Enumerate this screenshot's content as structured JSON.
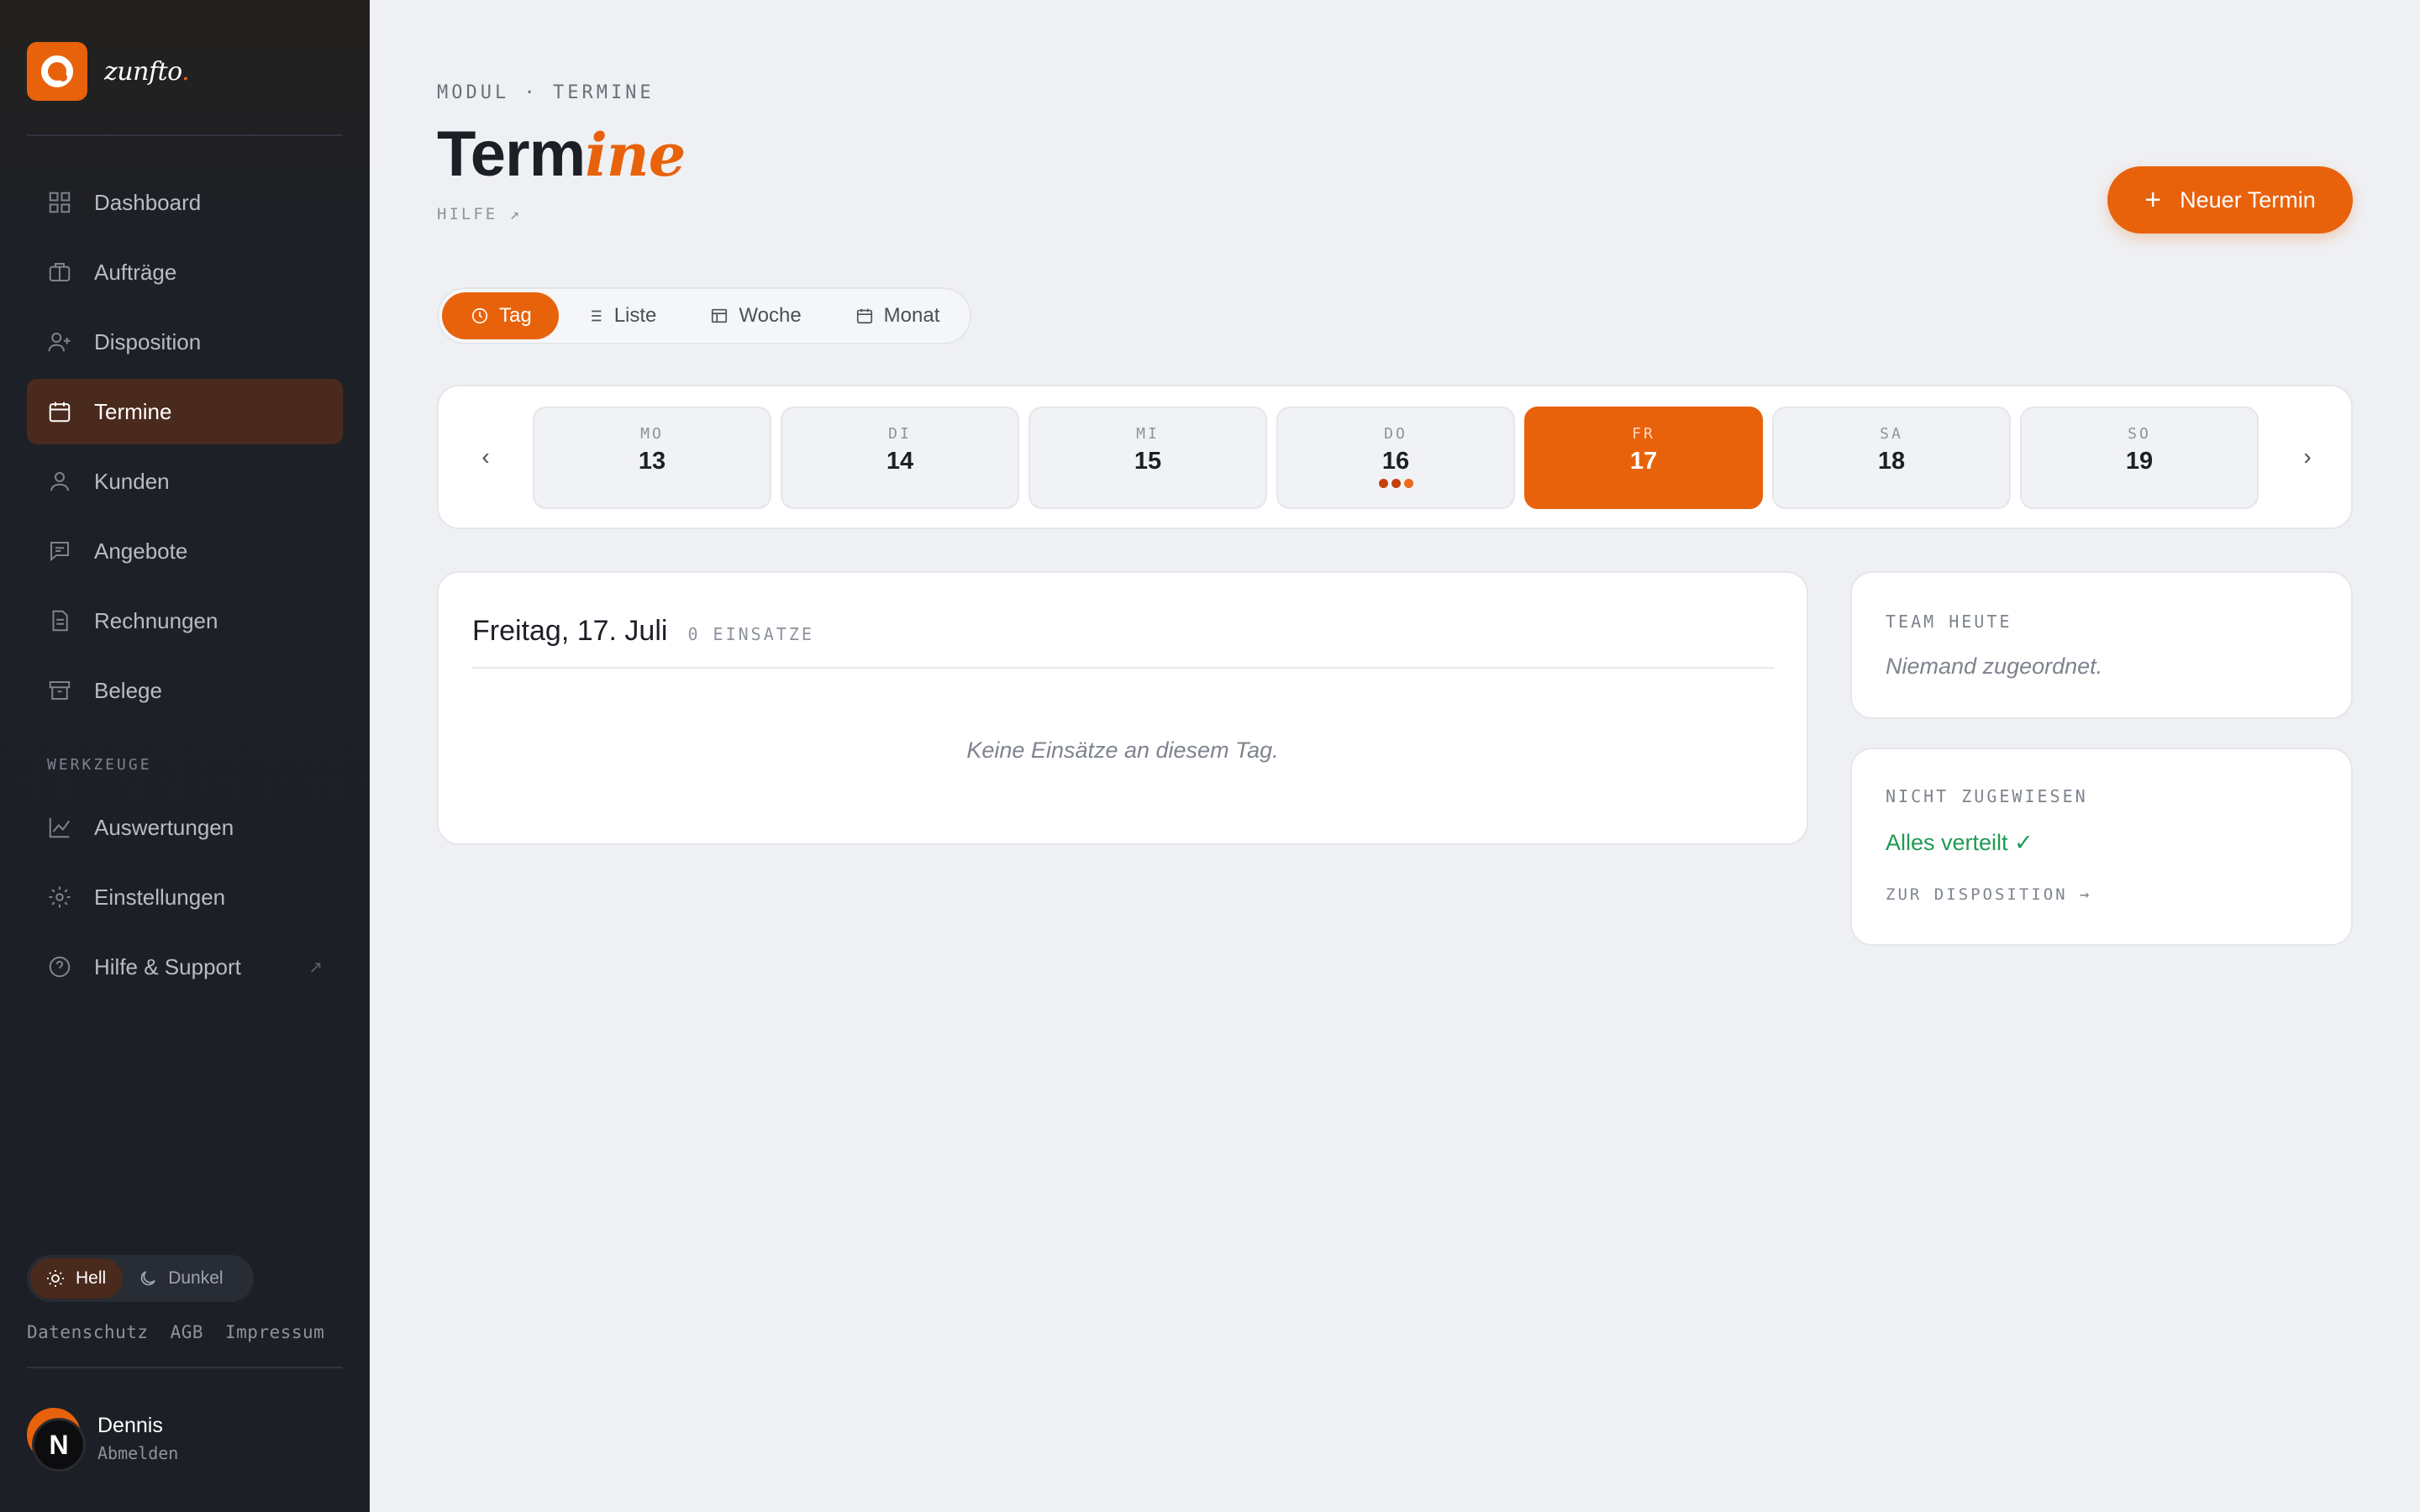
{
  "brand": {
    "name": "zunfto",
    "name_suffix": ".",
    "color": "#e8620c"
  },
  "sidebar": {
    "items": [
      {
        "label": "Dashboard",
        "icon": "grid-icon"
      },
      {
        "label": "Aufträge",
        "icon": "briefcase-icon"
      },
      {
        "label": "Disposition",
        "icon": "user-plus-icon"
      },
      {
        "label": "Termine",
        "icon": "calendar-icon",
        "active": true
      },
      {
        "label": "Kunden",
        "icon": "user-icon"
      },
      {
        "label": "Angebote",
        "icon": "message-icon"
      },
      {
        "label": "Rechnungen",
        "icon": "document-icon"
      },
      {
        "label": "Belege",
        "icon": "archive-icon"
      }
    ],
    "section_label": "WERKZEUGE",
    "tools": [
      {
        "label": "Auswertungen",
        "icon": "chart-icon"
      },
      {
        "label": "Einstellungen",
        "icon": "gear-icon"
      },
      {
        "label": "Hilfe & Support",
        "icon": "help-circle-icon",
        "external": "↗"
      }
    ],
    "theme": {
      "light_label": "Hell",
      "dark_label": "Dunkel",
      "selected": "Hell"
    },
    "legal_links": [
      "Datenschutz",
      "AGB",
      "Impressum"
    ],
    "user": {
      "name": "Dennis",
      "initial": "N",
      "logout_label": "Abmelden"
    }
  },
  "header": {
    "eyebrow": "MODUL · TERMINE",
    "title_plain": "Term",
    "title_accent": "ine",
    "help_link": "HILFE ↗",
    "new_button": {
      "icon": "+",
      "label": "Neuer Termin"
    }
  },
  "view_tabs": [
    {
      "label": "Tag",
      "icon": "clock-icon",
      "active": true
    },
    {
      "label": "Liste",
      "icon": "list-icon"
    },
    {
      "label": "Woche",
      "icon": "table-icon"
    },
    {
      "label": "Monat",
      "icon": "calendar-icon"
    }
  ],
  "week": {
    "prev": "‹",
    "next": "›",
    "days": [
      {
        "name": "MO",
        "num": "13"
      },
      {
        "name": "DI",
        "num": "14"
      },
      {
        "name": "MI",
        "num": "15"
      },
      {
        "name": "DO",
        "num": "16",
        "dots": [
          "#c2410c",
          "#c2410c",
          "#ea6a1f"
        ]
      },
      {
        "name": "FR",
        "num": "17",
        "selected": true
      },
      {
        "name": "SA",
        "num": "18"
      },
      {
        "name": "SO",
        "num": "19"
      }
    ]
  },
  "day_panel": {
    "date": "Freitag, 17. Juli",
    "count": "0 EINSATZE",
    "empty": "Keine Einsätze an diesem Tag."
  },
  "team_card": {
    "label": "TEAM HEUTE",
    "text": "Niemand zugeordnet."
  },
  "unassigned_card": {
    "label": "NICHT ZUGEWIESEN",
    "status": "Alles verteilt ✓",
    "link": "ZUR DISPOSITION →",
    "status_color": "#1f9a54"
  }
}
